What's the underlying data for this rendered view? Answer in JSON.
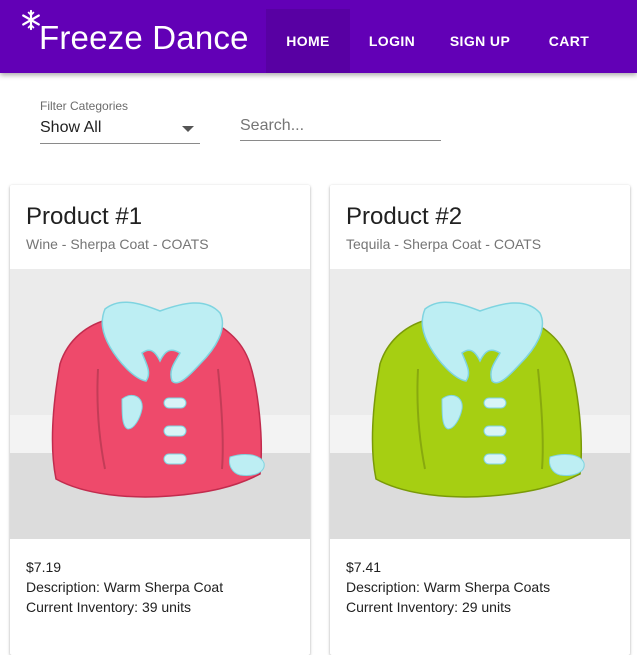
{
  "app": {
    "title": "Freeze Dance",
    "brand_color": "#6200b6"
  },
  "nav": {
    "home": "HOME",
    "login": "LOGIN",
    "signup": "SIGN UP",
    "cart": "CART",
    "active": "HOME"
  },
  "filter": {
    "label": "Filter Categories",
    "selected": "Show All"
  },
  "search": {
    "placeholder": "Search...",
    "value": ""
  },
  "products": [
    {
      "title": "Product #1",
      "subtitle": "Wine - Sherpa Coat - COATS",
      "image": "coat-icon",
      "coat_color": "#ee4a6b",
      "price": "$7.19",
      "description": "Description: Warm Sherpa Coat",
      "inventory": "Current Inventory: 39 units"
    },
    {
      "title": "Product #2",
      "subtitle": "Tequila - Sherpa Coat - COATS",
      "image": "coat-icon",
      "coat_color": "#a6cf12",
      "price": "$7.41",
      "description": "Description: Warm Sherpa Coats",
      "inventory": "Current Inventory: 29 units"
    }
  ]
}
